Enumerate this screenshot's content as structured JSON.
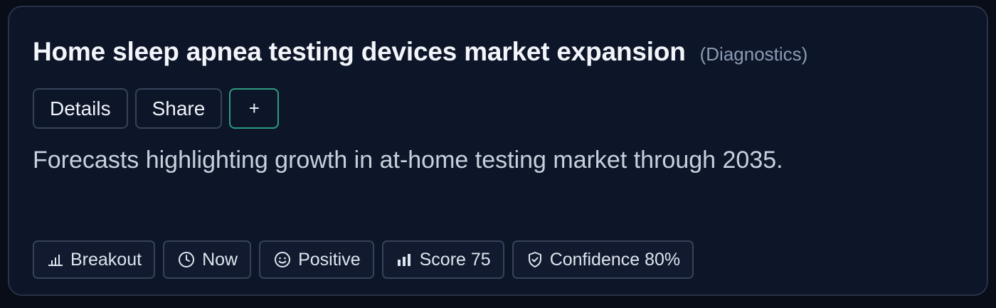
{
  "card": {
    "title": "Home sleep apnea testing devices market expansion",
    "category": "(Diagnostics)",
    "description": "Forecasts highlighting growth in at-home testing market through 2035."
  },
  "actions": {
    "details_label": "Details",
    "share_label": "Share",
    "add_label": "+"
  },
  "tags": [
    {
      "icon": "bar-chart-thin-icon",
      "label": "Breakout"
    },
    {
      "icon": "clock-icon",
      "label": "Now"
    },
    {
      "icon": "smiley-icon",
      "label": "Positive"
    },
    {
      "icon": "bar-chart-bold-icon",
      "label": "Score 75"
    },
    {
      "icon": "shield-check-icon",
      "label": "Confidence 80%"
    }
  ],
  "colors": {
    "background": "#080d18",
    "card": "#0d1528",
    "border": "#283349",
    "accent_green": "#2c9b7f",
    "muted_text": "#8b9ab3"
  }
}
